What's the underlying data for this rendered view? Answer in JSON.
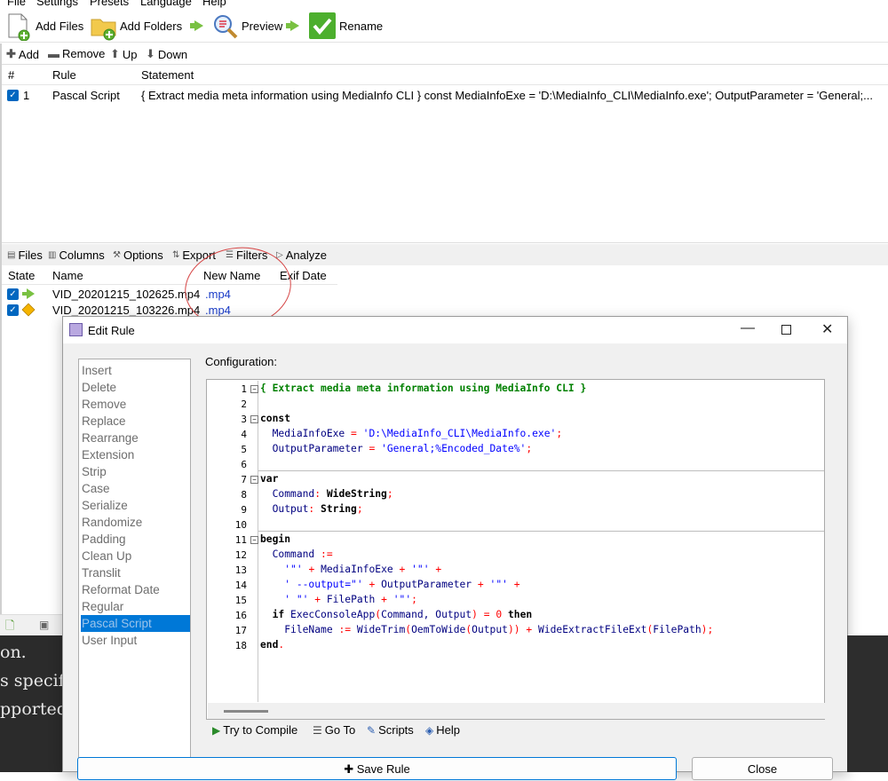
{
  "menu": [
    "File",
    "Settings",
    "Presets",
    "Language",
    "Help"
  ],
  "toolbar": {
    "add_files": "Add Files",
    "add_folders": "Add Folders",
    "preview": "Preview",
    "rename": "Rename"
  },
  "rules_toolbar": {
    "add": "Add",
    "remove": "Remove",
    "up": "Up",
    "down": "Down"
  },
  "rules_table": {
    "headers": [
      "#",
      "Rule",
      "Statement"
    ],
    "rows": [
      {
        "num": "1",
        "rule": "Pascal Script",
        "statement": "{ Extract media meta information using MediaInfo CLI } const MediaInfoExe = 'D:\\MediaInfo_CLI\\MediaInfo.exe'; OutputParameter = 'General;..."
      }
    ]
  },
  "tabs": [
    "Files",
    "Columns",
    "Options",
    "Export",
    "Filters",
    "Analyze"
  ],
  "files_table": {
    "headers": [
      "State",
      "Name",
      "New Name",
      "Exif Date"
    ],
    "rows": [
      {
        "name": "VID_20201215_102625.mp4",
        "new_name": ".mp4",
        "state": "ok"
      },
      {
        "name": "VID_20201215_103226.mp4",
        "new_name": ".mp4",
        "state": "warning"
      }
    ]
  },
  "background_text": [
    "on.",
    "s specific",
    "pported r"
  ],
  "dialog": {
    "title": "Edit Rule",
    "rule_list": [
      "Insert",
      "Delete",
      "Remove",
      "Replace",
      "Rearrange",
      "Extension",
      "Strip",
      "Case",
      "Serialize",
      "Randomize",
      "Padding",
      "Clean Up",
      "Translit",
      "Reformat Date",
      "Regular Expressions",
      "Pascal Script",
      "User Input"
    ],
    "selected_rule": "Pascal Script",
    "config_label": "Configuration:",
    "line_numbers": [
      "1",
      "2",
      "3",
      "4",
      "5",
      "6",
      "7",
      "8",
      "9",
      "10",
      "11",
      "12",
      "13",
      "14",
      "15",
      "16",
      "17",
      "18"
    ],
    "code": {
      "l1_comment": "{ Extract media meta information using MediaInfo CLI }",
      "const": "const",
      "exe_name": "MediaInfoExe",
      "exe_val": "'D:\\MediaInfo_CLI\\MediaInfo.exe'",
      "out_name": "OutputParameter",
      "out_val": "'General;%Encoded_Date%'",
      "var": "var",
      "cmd_name": "Command",
      "cmd_type": "WideString",
      "output_name": "Output",
      "output_type": "String",
      "begin": "begin",
      "l13_str1": "'\"'",
      "l13_id": "MediaInfoExe",
      "l13_str2": "'\"'",
      "l14_str1": "' --output=\"'",
      "l14_id": "OutputParameter",
      "l14_str2": "'\"'",
      "l15_str1": "' \"'",
      "l15_id": "FilePath",
      "l15_str2": "'\"'",
      "if": "if",
      "l16_fn": "ExecConsoleApp",
      "l16_args": "Command, Output",
      "zero": "0",
      "then": "then",
      "l17_lhs": "FileName",
      "l17_fn1": "WideTrim",
      "l17_fn2": "OemToWide",
      "l17_arg": "Output",
      "l17_fn3": "WideExtractFileExt",
      "l17_arg2": "FilePath",
      "end": "end"
    },
    "editor_buttons": {
      "compile": "Try to Compile",
      "goto": "Go To",
      "scripts": "Scripts",
      "help": "Help"
    },
    "save_rule": "Save Rule",
    "close": "Close"
  }
}
